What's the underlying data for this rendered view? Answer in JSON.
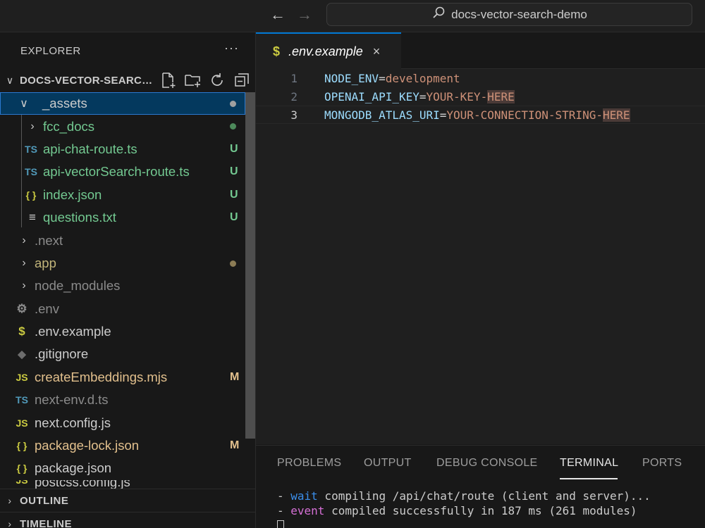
{
  "titlebar": {
    "search_text": "docs-vector-search-demo",
    "icons": [
      "arrow-back-icon",
      "arrow-forward-icon",
      "search-icon"
    ]
  },
  "sidebar": {
    "header": "EXPLORER",
    "more": "···",
    "folder_name": "DOCS-VECTOR-SEARCH-DEMO",
    "folder_actions": [
      "new-file-icon",
      "new-folder-icon",
      "refresh-icon",
      "collapse-all-icon"
    ],
    "items": [
      {
        "label": "_assets",
        "type": "folder-open",
        "badge": "",
        "dot": true
      },
      {
        "label": "fcc_docs",
        "type": "folder",
        "badge": "",
        "dot": true
      },
      {
        "label": "api-chat-route.ts",
        "type": "ts",
        "icon": "TS",
        "badge": "U"
      },
      {
        "label": "api-vectorSearch-route.ts",
        "type": "ts",
        "icon": "TS",
        "badge": "U"
      },
      {
        "label": "index.json",
        "type": "json",
        "icon": "{ }",
        "badge": "U"
      },
      {
        "label": "questions.txt",
        "type": "txt",
        "icon": "≡",
        "badge": "U"
      },
      {
        "label": ".next",
        "type": "folder",
        "badge": ""
      },
      {
        "label": "app",
        "type": "folder",
        "badge": "",
        "dot": true
      },
      {
        "label": "node_modules",
        "type": "folder",
        "badge": ""
      },
      {
        "label": ".env",
        "type": "env",
        "icon": "⚙",
        "badge": ""
      },
      {
        "label": ".env.example",
        "type": "env",
        "icon": "$",
        "badge": ""
      },
      {
        "label": ".gitignore",
        "type": "git",
        "icon": "◆",
        "badge": ""
      },
      {
        "label": "createEmbeddings.mjs",
        "type": "js",
        "icon": "JS",
        "badge": "M"
      },
      {
        "label": "next-env.d.ts",
        "type": "ts",
        "icon": "TS",
        "badge": ""
      },
      {
        "label": "next.config.js",
        "type": "js",
        "icon": "JS",
        "badge": ""
      },
      {
        "label": "package-lock.json",
        "type": "json",
        "icon": "{ }",
        "badge": "M"
      },
      {
        "label": "package.json",
        "type": "json",
        "icon": "{ }",
        "badge": ""
      },
      {
        "label": "postcss.config.js",
        "type": "js",
        "icon": "JS",
        "badge": ""
      }
    ],
    "sections": [
      "OUTLINE",
      "TIMELINE"
    ]
  },
  "editor": {
    "tab_icon": "$",
    "tab_label": ".env.example",
    "tab_close": "×",
    "lines": [
      {
        "num": "1",
        "key": "NODE_ENV",
        "eq": "=",
        "value": "development",
        "hl": ""
      },
      {
        "num": "2",
        "key": "OPENAI_API_KEY",
        "eq": "=",
        "value": "YOUR-KEY-",
        "hl": "HERE"
      },
      {
        "num": "3",
        "key": "MONGODB_ATLAS_URI",
        "eq": "=",
        "value": "YOUR-CONNECTION-STRING-",
        "hl": "HERE"
      }
    ]
  },
  "panel": {
    "tabs": [
      "PROBLEMS",
      "OUTPUT",
      "DEBUG CONSOLE",
      "TERMINAL",
      "PORTS"
    ],
    "active_tab": "TERMINAL",
    "terminal": [
      {
        "prefix": "- ",
        "tag": "wait",
        "text": " compiling /api/chat/route (client and server)..."
      },
      {
        "prefix": "- ",
        "tag": "event",
        "text": " compiled successfully in 187 ms (261 modules)"
      }
    ]
  },
  "colors": {
    "accent": "#0078d4",
    "untracked": "#73c991",
    "modified": "#e2c08d",
    "selection": "#04395e"
  }
}
